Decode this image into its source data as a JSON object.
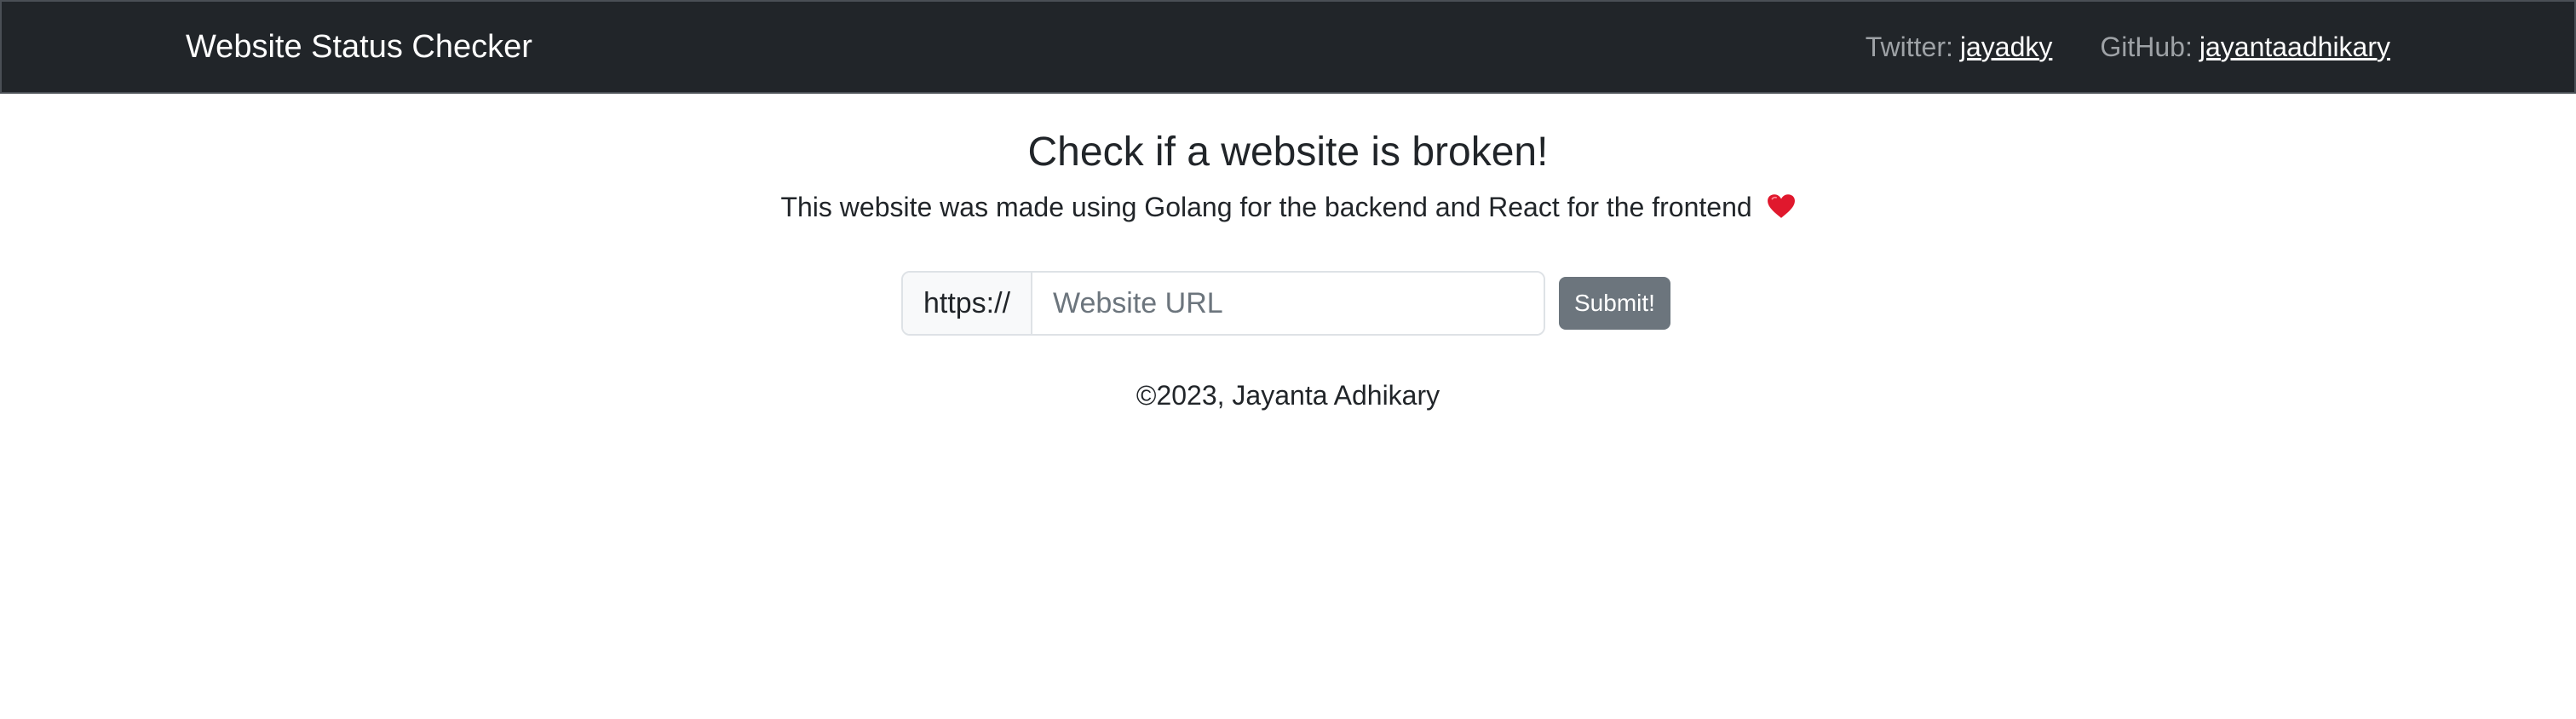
{
  "navbar": {
    "brand": "Website Status Checker",
    "twitter_label": "Twitter:",
    "twitter_handle": "jayadky",
    "github_label": "GitHub:",
    "github_handle": "jayantaadhikary"
  },
  "main": {
    "title": "Check if a website is broken!",
    "subtitle": "This website was made using Golang for the backend and React for the frontend",
    "subtitle_icon": "heart-icon"
  },
  "form": {
    "prefix": "https://",
    "url_value": "",
    "url_placeholder": "Website URL",
    "submit_label": "Submit!"
  },
  "footer": {
    "copyright": "©2023, Jayanta Adhikary"
  },
  "colors": {
    "navbar_bg": "#212529",
    "submit_bg": "#6c757d",
    "heart": "#e0182d"
  }
}
